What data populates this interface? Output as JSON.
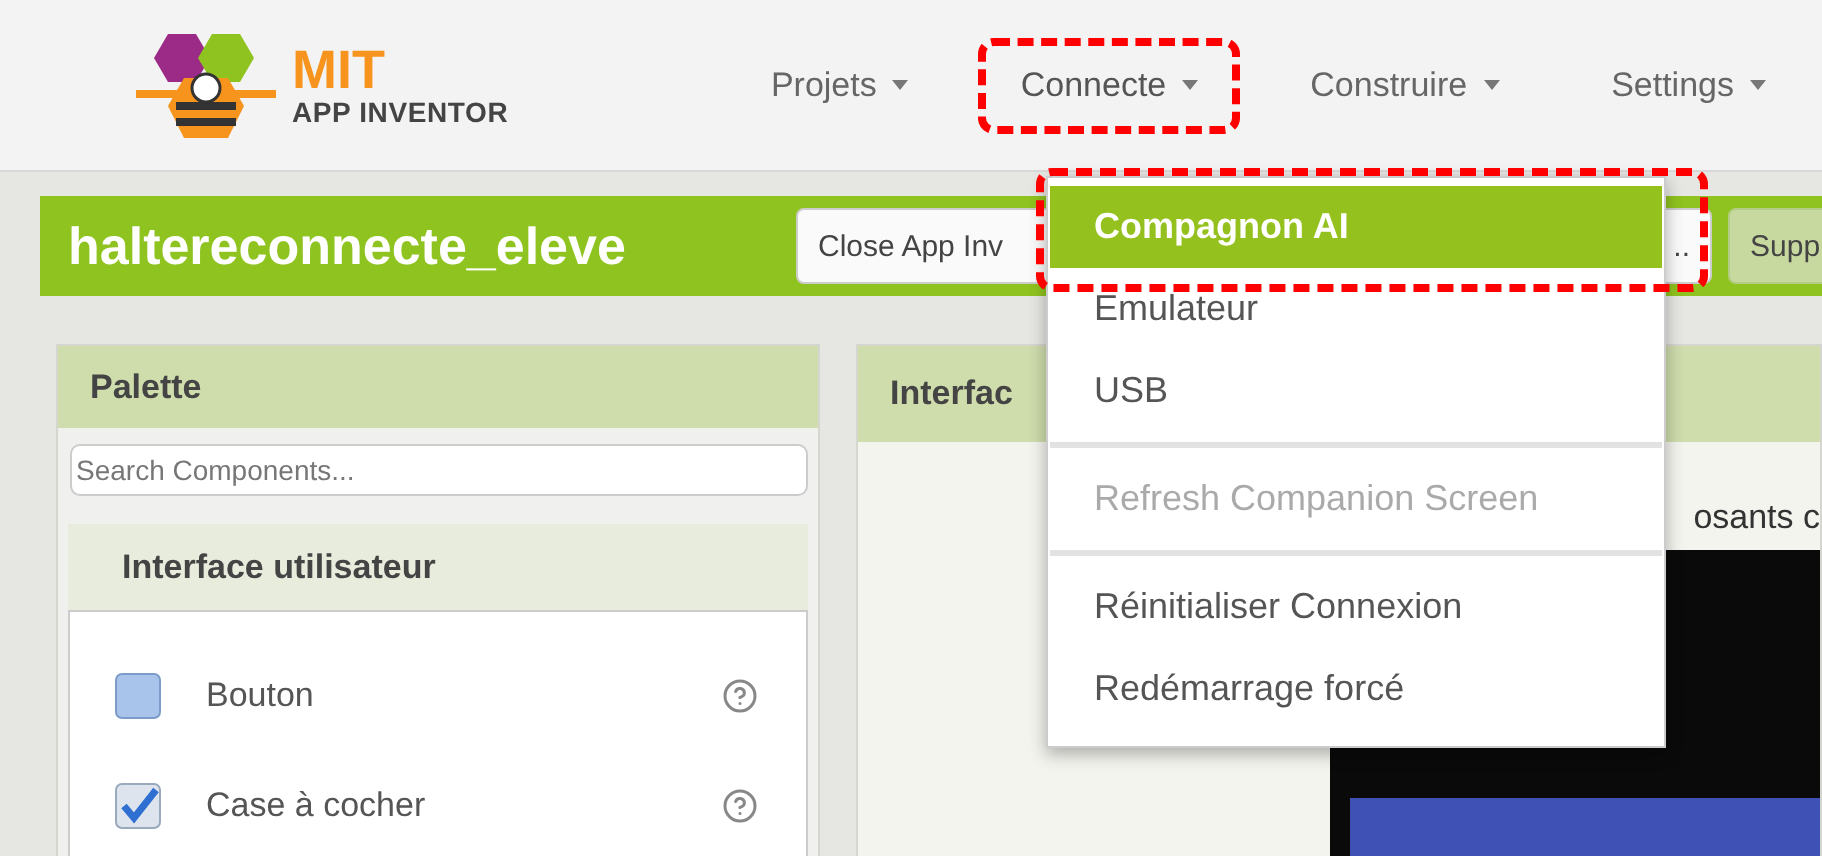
{
  "header": {
    "logo": {
      "title": "MIT",
      "subtitle": "APP INVENTOR"
    },
    "menus": [
      {
        "label": "Projets",
        "open": false,
        "annotated": false
      },
      {
        "label": "Connecte",
        "open": true,
        "annotated": true
      },
      {
        "label": "Construire",
        "open": false,
        "annotated": false
      },
      {
        "label": "Settings",
        "open": false,
        "annotated": false
      }
    ]
  },
  "connect_menu": {
    "items": [
      {
        "kind": "item",
        "label": "Compagnon AI",
        "selected": true,
        "disabled": false,
        "annotated": true
      },
      {
        "kind": "item",
        "label": "Emulateur",
        "selected": false,
        "disabled": false,
        "annotated": false
      },
      {
        "kind": "item",
        "label": "USB",
        "selected": false,
        "disabled": false,
        "annotated": false
      },
      {
        "kind": "divider"
      },
      {
        "kind": "item",
        "label": "Refresh Companion Screen",
        "selected": false,
        "disabled": true,
        "annotated": false
      },
      {
        "kind": "divider"
      },
      {
        "kind": "item",
        "label": "Réinitialiser Connexion",
        "selected": false,
        "disabled": false,
        "annotated": false
      },
      {
        "kind": "item",
        "label": "Redémarrage forcé",
        "selected": false,
        "disabled": false,
        "annotated": false
      }
    ]
  },
  "project": {
    "title": "haltereconnecte_eleve",
    "buttons": [
      {
        "label": "Close App Inv",
        "kind": "plain"
      },
      {
        "label": "..",
        "kind": "plain"
      },
      {
        "label": "Supp",
        "kind": "green"
      }
    ]
  },
  "palette": {
    "title": "Palette",
    "search": {
      "placeholder": "Search Components..."
    },
    "category": "Interface utilisateur",
    "items": [
      {
        "kind": "button",
        "label": "Bouton"
      },
      {
        "kind": "checkbox",
        "label": "Case à cocher"
      }
    ]
  },
  "viewer": {
    "title": "Interfac",
    "caption": "osants c"
  }
}
